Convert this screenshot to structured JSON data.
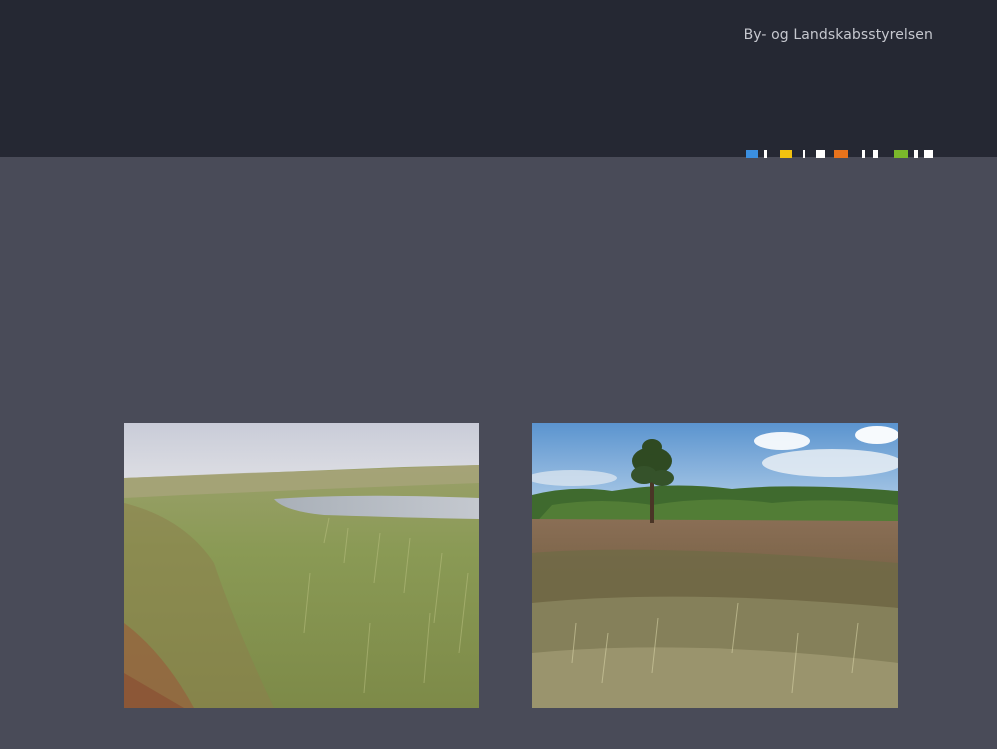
{
  "header": {
    "organization": "By- og Landskabsstyrelsen",
    "logo_colors": [
      "#3b8fe0",
      "#f2c20f",
      "#e8731c",
      "#7ab82b",
      "#ffffff"
    ]
  },
  "colors": {
    "header_bg": "#252833",
    "page_bg": "#494b58"
  },
  "photos": [
    {
      "subject": "wet-dune-slack-photo"
    },
    {
      "subject": "heathland-with-pine-photo"
    }
  ]
}
